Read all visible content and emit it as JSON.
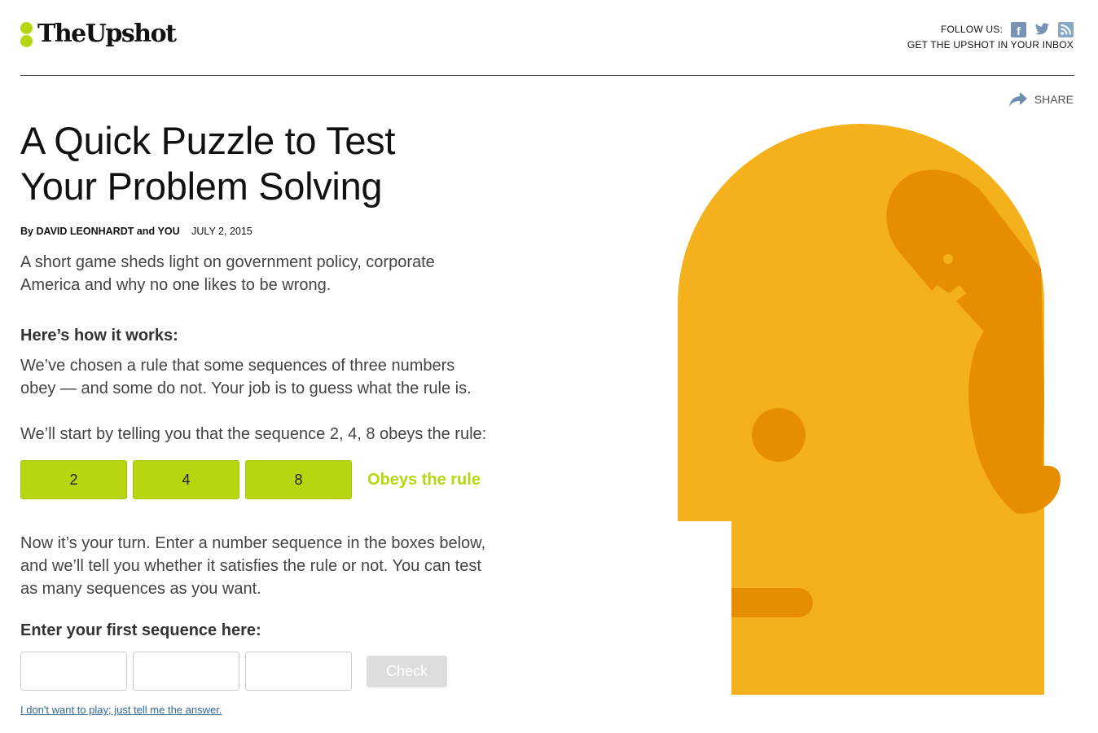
{
  "header": {
    "logo_text": "TheUpshot",
    "follow_label": "FOLLOW US:",
    "social_icons": [
      "facebook-icon",
      "twitter-icon",
      "rss-icon"
    ],
    "inbox_link": "GET THE UPSHOT IN YOUR INBOX",
    "share_label": "SHARE"
  },
  "article": {
    "headline_line1": "A Quick Puzzle to Test",
    "headline_line2": "Your Problem Solving",
    "byline": {
      "by": "By",
      "author": "DAVID LEONHARDT",
      "and": "and",
      "coauthor": "YOU",
      "date": "JULY 2, 2015"
    },
    "summary_line1": "A short game sheds light on government policy, corporate",
    "summary_line2": "America and why no one likes to be wrong.",
    "how_heading": "Here’s how it works:",
    "p1_line1": "We’ve chosen a rule that some sequences of three numbers",
    "p1_line2": "obey — and some do not. Your job is to guess what the rule is.",
    "p2": "We’ll start by telling you that the sequence 2, 4, 8 obeys the rule:",
    "example_sequence": [
      "2",
      "4",
      "8"
    ],
    "example_result": "Obeys the rule",
    "p3_line1": "Now it’s your turn. Enter a number sequence in the boxes below,",
    "p3_line2": "and we’ll tell you whether it satisfies the rule or not. You can test",
    "p3_line3": "as many sequences as you want.",
    "enter_heading": "Enter your first sequence here:",
    "inputs": [
      "",
      "",
      ""
    ],
    "check_label": "Check",
    "answer_link": "I don't want to play; just tell me the answer."
  },
  "colors": {
    "accent_green": "#b8d60f",
    "head_yellow": "#f5b11b",
    "head_orange": "#e68d00",
    "link_blue": "#326891"
  }
}
